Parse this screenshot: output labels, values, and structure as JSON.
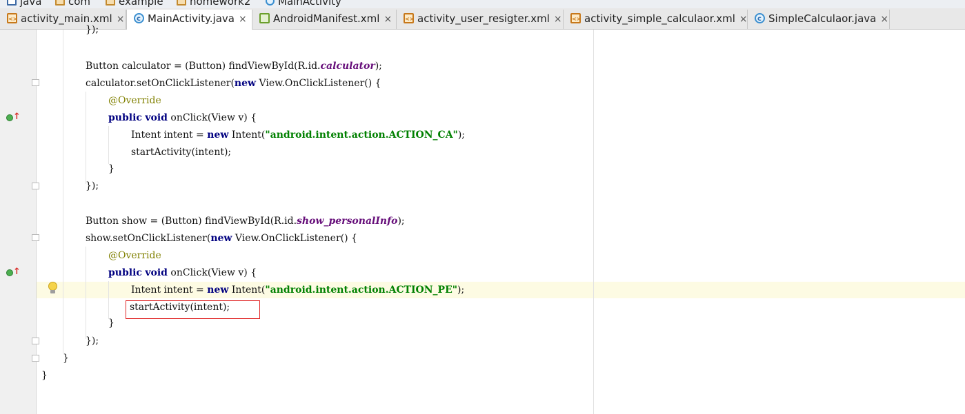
{
  "breadcrumb": {
    "items": [
      {
        "label": "java",
        "icon": "folder-icon"
      },
      {
        "label": "com",
        "icon": "package-icon"
      },
      {
        "label": "example",
        "icon": "package-icon"
      },
      {
        "label": "homework2",
        "icon": "package-icon"
      },
      {
        "label": "MainActivity",
        "icon": "class-icon"
      }
    ]
  },
  "tabs": [
    {
      "label": "activity_main.xml",
      "icon": "xml-file-icon",
      "active": false
    },
    {
      "label": "MainActivity.java",
      "icon": "java-class-icon",
      "active": true
    },
    {
      "label": "AndroidManifest.xml",
      "icon": "manifest-file-icon",
      "active": false
    },
    {
      "label": "activity_user_resigter.xml",
      "icon": "xml-file-icon",
      "active": false
    },
    {
      "label": "activity_simple_calculaor.xml",
      "icon": "xml-file-icon",
      "active": false
    },
    {
      "label": "SimpleCalculaor.java",
      "icon": "java-class-icon",
      "active": false
    }
  ],
  "close_glyph": "×",
  "colors": {
    "keyword": "#000080",
    "annotation": "#808000",
    "string": "#008000",
    "field": "#660e7a",
    "current_line": "#fdfbe3",
    "error_box": "#e02424"
  },
  "code": {
    "l0": "});",
    "l2": {
      "a": "Button calculator = (Button) findViewById(R.id.",
      "f": "calculator",
      "b": ");"
    },
    "l3": {
      "a": "calculator.setOnClickListener(",
      "k": "new",
      "b": " View.OnClickListener() {"
    },
    "l4": "@Override",
    "l5": {
      "k1": "public",
      "k2": "void",
      "b": " onClick(View v) {"
    },
    "l6": {
      "a": "Intent intent = ",
      "k": "new",
      "b": " Intent(",
      "s": "\"android.intent.action.ACTION_CA\"",
      "c": ");"
    },
    "l7": "startActivity(intent);",
    "l8": "}",
    "l9": "});",
    "l11": {
      "a": "Button show = (Button) findViewById(R.id.",
      "f": "show_personalInfo",
      "b": ");"
    },
    "l12": {
      "a": "show.setOnClickListener(",
      "k": "new",
      "b": " View.OnClickListener() {"
    },
    "l13": "@Override",
    "l14": {
      "k1": "public",
      "k2": "void",
      "b": " onClick(View v) {"
    },
    "l15": {
      "a": "Intent intent = ",
      "k": "new",
      "b": " Intent(",
      "s": "\"android.intent.action.ACTION_PE\"",
      "c": ");"
    },
    "l16": "startActivity(intent);",
    "l17": "}",
    "l18": "});",
    "l19": "}",
    "l20": "}"
  }
}
